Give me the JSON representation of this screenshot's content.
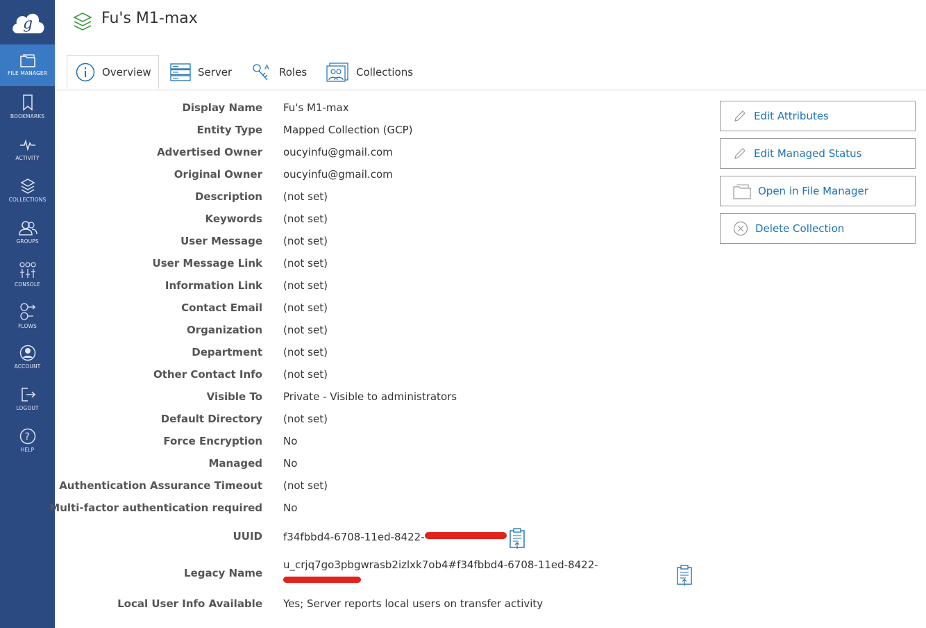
{
  "header": {
    "title": "Fu's M1-max"
  },
  "sidebar": {
    "items": [
      {
        "label": "FILE MANAGER"
      },
      {
        "label": "BOOKMARKS"
      },
      {
        "label": "ACTIVITY"
      },
      {
        "label": "COLLECTIONS"
      },
      {
        "label": "GROUPS"
      },
      {
        "label": "CONSOLE"
      },
      {
        "label": "FLOWS"
      },
      {
        "label": "ACCOUNT"
      },
      {
        "label": "LOGOUT"
      },
      {
        "label": "HELP"
      }
    ]
  },
  "tabs": [
    {
      "label": "Overview"
    },
    {
      "label": "Server"
    },
    {
      "label": "Roles"
    },
    {
      "label": "Collections"
    }
  ],
  "fields": [
    {
      "label": "Display Name",
      "value": "Fu's M1-max"
    },
    {
      "label": "Entity Type",
      "value": "Mapped Collection (GCP)"
    },
    {
      "label": "Advertised Owner",
      "value": "oucyinfu@gmail.com"
    },
    {
      "label": "Original Owner",
      "value": "oucyinfu@gmail.com"
    },
    {
      "label": "Description",
      "value": "(not set)"
    },
    {
      "label": "Keywords",
      "value": "(not set)"
    },
    {
      "label": "User Message",
      "value": "(not set)"
    },
    {
      "label": "User Message Link",
      "value": "(not set)"
    },
    {
      "label": "Information Link",
      "value": "(not set)"
    },
    {
      "label": "Contact Email",
      "value": "(not set)"
    },
    {
      "label": "Organization",
      "value": "(not set)"
    },
    {
      "label": "Department",
      "value": "(not set)"
    },
    {
      "label": "Other Contact Info",
      "value": "(not set)"
    },
    {
      "label": "Visible To",
      "value": "Private - Visible to administrators"
    },
    {
      "label": "Default Directory",
      "value": "(not set)"
    },
    {
      "label": "Force Encryption",
      "value": "No"
    },
    {
      "label": "Managed",
      "value": "No"
    },
    {
      "label": "Authentication Assurance Timeout",
      "value": "(not set)"
    },
    {
      "label": "Multi-factor authentication required",
      "value": "No"
    }
  ],
  "uuid": {
    "label": "UUID",
    "value": "f34fbbd4-6708-11ed-8422-"
  },
  "legacy": {
    "label": "Legacy Name",
    "value": "u_crjq7go3pbgwrasb2izlxk7ob4#f34fbbd4-6708-11ed-8422-"
  },
  "local_user": {
    "label": "Local User Info Available",
    "value": "Yes; Server reports local users on transfer activity"
  },
  "actions": [
    {
      "label": "Edit Attributes"
    },
    {
      "label": "Edit Managed Status"
    },
    {
      "label": "Open in File Manager"
    },
    {
      "label": "Delete Collection"
    }
  ],
  "colors": {
    "sidebar": "#2c4a82",
    "active": "#3a79c4",
    "link": "#1d72b8",
    "redaction": "#e0231c"
  }
}
